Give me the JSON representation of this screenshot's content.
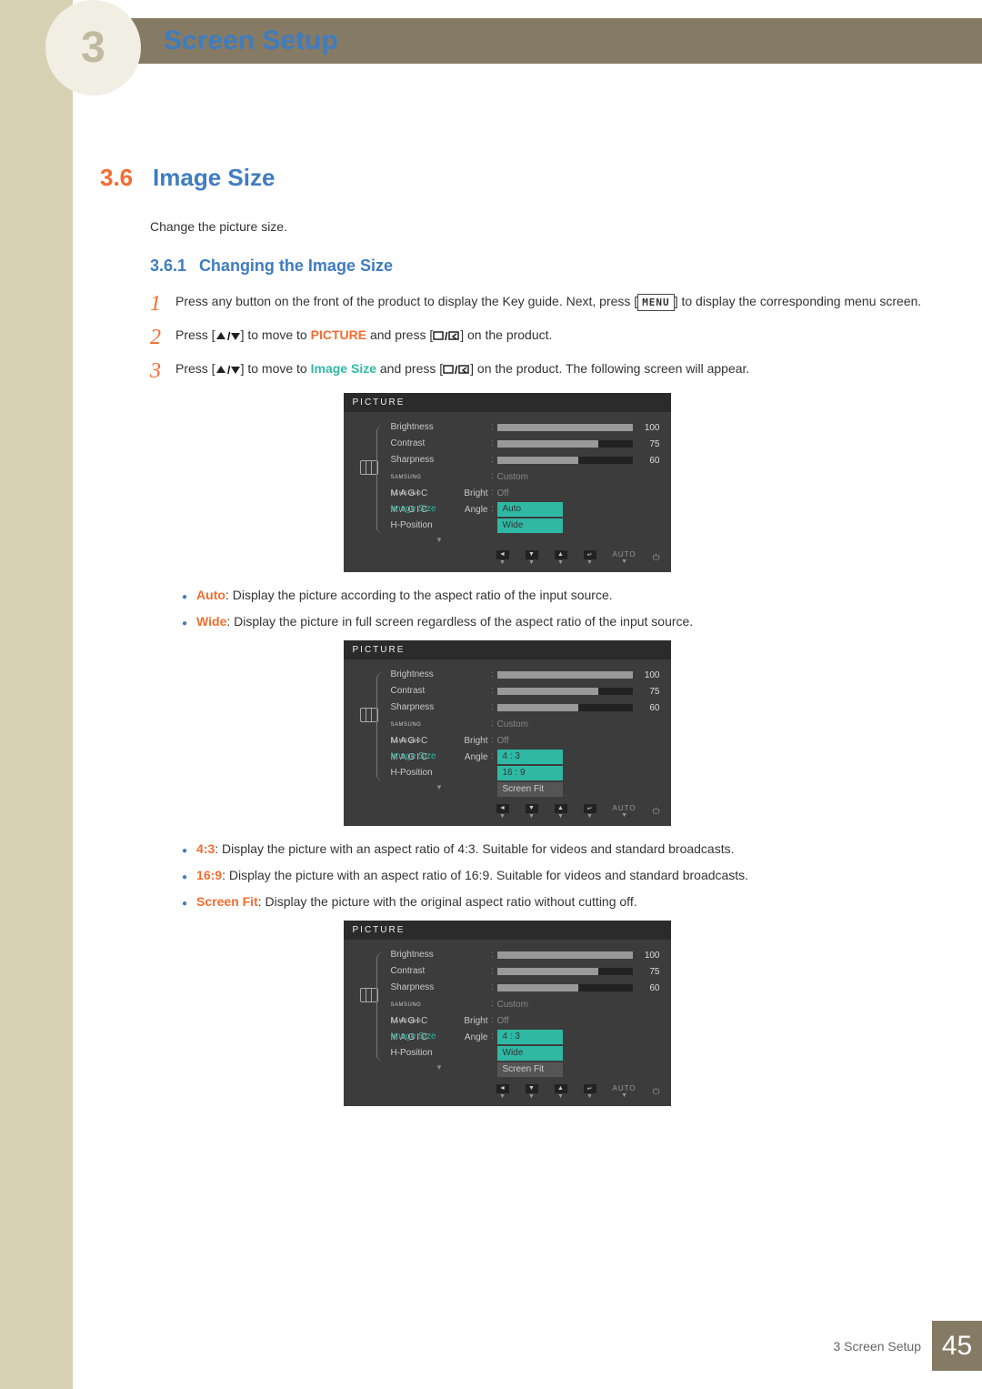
{
  "header": {
    "chapter_title": "Screen Setup",
    "chapter_num": "3"
  },
  "section": {
    "number": "3.6",
    "title": "Image Size",
    "intro": "Change the picture size."
  },
  "subsection": {
    "number": "3.6.1",
    "title": "Changing the Image Size"
  },
  "steps": {
    "s1": {
      "num": "1",
      "pre": "Press any button on the front of the product to display the Key guide. Next, press [",
      "btn": "MENU",
      "post": "] to display the corresponding menu screen."
    },
    "s2": {
      "num": "2",
      "a": "Press [",
      "b": "] to move to ",
      "hl1": "PICTURE",
      "c": " and press [",
      "d": "] on the product."
    },
    "s3": {
      "num": "3",
      "a": "Press [",
      "b": "] to move to ",
      "hl1": "Image Size",
      "c": " and press [",
      "d": "] on the product. The following screen will appear."
    }
  },
  "bullets": {
    "b1_hl": "Auto",
    "b1_t": ": Display the picture according to the aspect ratio of the input source.",
    "b2_hl": "Wide",
    "b2_t": ": Display the picture in full screen regardless of the aspect ratio of the input source.",
    "b3_hl": "4:3",
    "b3_t": ": Display the picture with an aspect ratio of 4:3. Suitable for videos and standard broadcasts.",
    "b4_hl": "16:9",
    "b4_t": ": Display the picture with an aspect ratio of 16:9. Suitable for videos and standard broadcasts.",
    "b5_hl": "Screen Fit",
    "b5_t": ": Display the picture with the original aspect ratio without cutting off."
  },
  "osd_common": {
    "title": "PICTURE",
    "labels": {
      "brightness": "Brightness",
      "contrast": "Contrast",
      "sharpness": "Sharpness",
      "magic_pre": "SAMSUNG",
      "magic_main": "MAGIC",
      "magic_bright": "Bright",
      "magic_angle": "Angle",
      "image_size": "Image Size",
      "hpos": "H-Position"
    },
    "values": {
      "brightness": "100",
      "contrast": "75",
      "sharpness": "60",
      "custom": "Custom",
      "off": "Off"
    },
    "nav_auto": "AUTO"
  },
  "osd1": {
    "optA": "Auto",
    "optB": "Wide"
  },
  "osd2": {
    "optA": "4 : 3",
    "optB": "16 : 9",
    "optC": "Screen Fit"
  },
  "osd3": {
    "optA": "4 : 3",
    "optB": "Wide",
    "optC": "Screen Fit"
  },
  "footer": {
    "text": "3 Screen Setup",
    "page": "45"
  }
}
